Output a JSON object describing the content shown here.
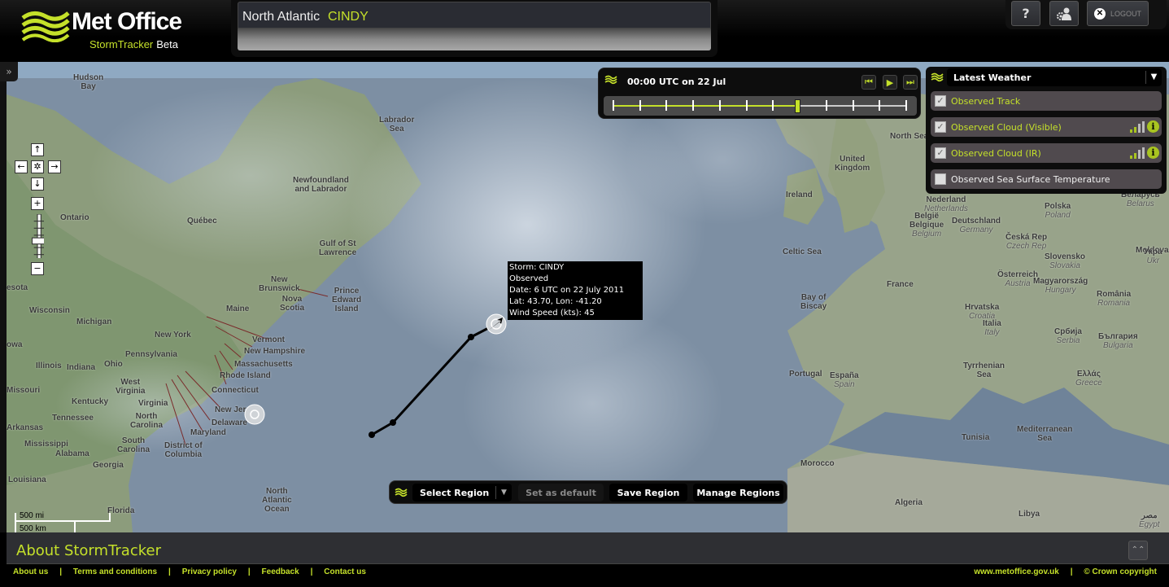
{
  "header": {
    "brand": "Met Office",
    "product": "StormTracker",
    "badge": "Beta",
    "storm_region": "North Atlantic",
    "storm_name": "CINDY",
    "help_label": "?",
    "logout_label": "LOGOUT"
  },
  "side_toggle": "»",
  "nav": {
    "up": "↑",
    "down": "↓",
    "left": "←",
    "right": "→",
    "center": "✲",
    "zoom_in": "+",
    "zoom_out": "−"
  },
  "timeline": {
    "time": "00:00 UTC on 22 Jul",
    "ticks": 12,
    "position_index": 7,
    "buttons": {
      "first": "⏮",
      "play": "▶",
      "last": "⏭"
    }
  },
  "layers": {
    "selected_group": "Latest Weather",
    "items": [
      {
        "label": "Observed Track",
        "checked": true,
        "signal": false,
        "info": false
      },
      {
        "label": "Observed Cloud (Visible)",
        "checked": true,
        "signal": true,
        "info": true
      },
      {
        "label": "Observed Cloud (IR)",
        "checked": true,
        "signal": true,
        "info": true
      },
      {
        "label": "Observed Sea Surface Temperature",
        "checked": false,
        "signal": false,
        "info": false
      }
    ]
  },
  "tooltip": {
    "storm": "Storm: CINDY",
    "status": "Observed",
    "date": "Date: 6 UTC on 22 July 2011",
    "latlon": "Lat: 43.70, Lon: -41.20",
    "wind": "Wind Speed (kts): 45"
  },
  "regionbar": {
    "select": "Select Region",
    "set_default": "Set as default",
    "save": "Save Region",
    "manage": "Manage Regions"
  },
  "scale": {
    "mi": "500 mi",
    "km": "500 km"
  },
  "about": {
    "title": "About StormTracker",
    "up": "⌃⌃"
  },
  "footer": {
    "links": [
      "About us",
      "Terms and conditions",
      "Privacy policy",
      "Feedback",
      "Contact us"
    ],
    "site": "www.metoffice.gov.uk",
    "copyright": "© Crown copyright"
  },
  "map_labels": [
    {
      "t": "Hudson\nBay"
    },
    {
      "t": "Labrador\nSea"
    },
    {
      "t": "Newfoundland\nand Labrador"
    },
    {
      "t": "Ontario"
    },
    {
      "t": "Québec"
    },
    {
      "t": "Gulf of St\nLawrence"
    },
    {
      "t": "New\nBrunswick"
    },
    {
      "t": "Prince\nEdward\nIsland"
    },
    {
      "t": "Nova\nScotia"
    },
    {
      "t": "Maine"
    },
    {
      "t": "Wisconsin"
    },
    {
      "t": "Michigan"
    },
    {
      "t": "New York"
    },
    {
      "t": "Vermont"
    },
    {
      "t": "New Hampshire"
    },
    {
      "t": "Massachusetts"
    },
    {
      "t": "Rhode Island"
    },
    {
      "t": "Connecticut"
    },
    {
      "t": "Pennsylvania"
    },
    {
      "t": "Illinois"
    },
    {
      "t": "Indiana"
    },
    {
      "t": "Ohio"
    },
    {
      "t": "West\nVirginia"
    },
    {
      "t": "Missouri"
    },
    {
      "t": "Kentucky"
    },
    {
      "t": "Virginia"
    },
    {
      "t": "New Jersey"
    },
    {
      "t": "Delaware"
    },
    {
      "t": "Maryland"
    },
    {
      "t": "Tennessee"
    },
    {
      "t": "North\nCarolina"
    },
    {
      "t": "Arkansas"
    },
    {
      "t": "South\nCarolina"
    },
    {
      "t": "District of\nColumbia"
    },
    {
      "t": "Mississippi"
    },
    {
      "t": "Alabama"
    },
    {
      "t": "Georgia"
    },
    {
      "t": "Louisiana"
    },
    {
      "t": "Florida"
    },
    {
      "t": "North\nAtlantic\nOcean"
    },
    {
      "t": "North Sea"
    },
    {
      "t": "United\nKingdom"
    },
    {
      "t": "Ireland"
    },
    {
      "t": "Celtic Sea"
    },
    {
      "t": "Bay of\nBiscay"
    },
    {
      "t": "France"
    },
    {
      "t": "Portugal"
    },
    {
      "t": "España",
      "i": "Spain"
    },
    {
      "t": "Nederland",
      "i": "Netherlands"
    },
    {
      "t": "België\nBelgique",
      "i": "Belgium"
    },
    {
      "t": "Deutschland",
      "i": "Germany"
    },
    {
      "t": "Polska",
      "i": "Poland"
    },
    {
      "t": "Česká Rep",
      "i": "Czech Rep"
    },
    {
      "t": "Slovensko",
      "i": "Slovakia"
    },
    {
      "t": "Österreich",
      "i": "Austria"
    },
    {
      "t": "Magyarország",
      "i": "Hungary"
    },
    {
      "t": "Hrvatska",
      "i": "Croatia"
    },
    {
      "t": "Italia",
      "i": "Italy"
    },
    {
      "t": "Србија",
      "i": "Serbia"
    },
    {
      "t": "România",
      "i": "Romania"
    },
    {
      "t": "България",
      "i": "Bulgaria"
    },
    {
      "t": "Ελλάς",
      "i": "Greece"
    },
    {
      "t": "Tyrrhenian\nSea"
    },
    {
      "t": "Moldova"
    },
    {
      "t": "Укра",
      "i": "Ukr"
    },
    {
      "t": "Беларусь",
      "i": "Belarus"
    },
    {
      "t": "Morocco"
    },
    {
      "t": "Algeria"
    },
    {
      "t": "Tunisia"
    },
    {
      "t": "Mediterranean\nSea"
    },
    {
      "t": "Libya"
    },
    {
      "t": "مصر",
      "i": "Egypt"
    },
    {
      "t": "esota"
    },
    {
      "t": "owa"
    }
  ],
  "colors": {
    "accent": "#c4e02a",
    "panel": "#0d0d0d",
    "layer_row": "#504a4e"
  }
}
